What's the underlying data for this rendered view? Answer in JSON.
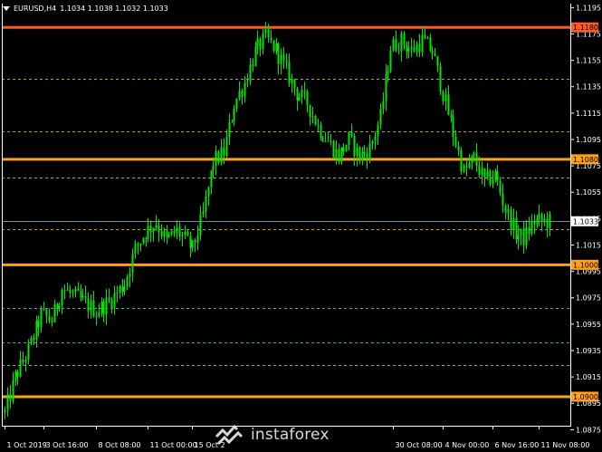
{
  "header": {
    "symbol_timeframe": "EURUSD,H4",
    "ohlc": "1.1034 1.1038 1.1032 1.1033"
  },
  "watermark": {
    "text": "instaforex"
  },
  "colors": {
    "background": "#000000",
    "candle": "#00e600",
    "axis": "#ffffff",
    "resistance_red": "#ff5a1f",
    "level_orange": "#ff9f1a",
    "dashed_yellow": "#c8a000",
    "dashed_teal": "#3aa8a8",
    "current_price_line": "#7d8896",
    "current_price_tag": "#ffffff"
  },
  "chart_data": {
    "type": "candlestick",
    "symbol": "EURUSD",
    "timeframe": "H4",
    "ylim": [
      1.0878,
      1.1198
    ],
    "price_ticks": [
      "1.1195",
      "1.1175",
      "1.1155",
      "1.1135",
      "1.1115",
      "1.1095",
      "1.1075",
      "1.1055",
      "1.1035",
      "1.1015",
      "1.0995",
      "1.0975",
      "1.0955",
      "1.0935",
      "1.0915",
      "1.0895",
      "1.0875"
    ],
    "date_ticks": [
      {
        "label": "1 Oct 2019",
        "index": 0
      },
      {
        "label": "3 Oct 16:00",
        "index": 15
      },
      {
        "label": "8 Oct 08:00",
        "index": 35
      },
      {
        "label": "11 Oct 00:00",
        "index": 55
      },
      {
        "label": "15 Oct 2",
        "index": 72
      },
      {
        "label": "30 Oct 08:00",
        "index": 149
      },
      {
        "label": "4 Nov 00:00",
        "index": 168
      },
      {
        "label": "6 Nov 16:00",
        "index": 187
      },
      {
        "label": "11 Nov 08:00",
        "index": 205
      }
    ],
    "candle_count": 210,
    "levels": [
      {
        "price": 1.118,
        "label": "1.1180",
        "style": "solid",
        "color": "resistance_red"
      },
      {
        "price": 1.108,
        "label": "1.1080",
        "style": "solid",
        "color": "level_orange"
      },
      {
        "price": 1.1,
        "label": "1.1000",
        "style": "solid",
        "color": "level_orange"
      },
      {
        "price": 1.09,
        "label": "1.0900",
        "style": "solid",
        "color": "level_orange"
      },
      {
        "price": 1.1141,
        "style": "dashed",
        "color": "dashed_yellow"
      },
      {
        "price": 1.1101,
        "style": "dashed",
        "color": "dashed_yellow"
      },
      {
        "price": 1.1066,
        "style": "dashed",
        "color": "dashed_yellow"
      },
      {
        "price": 1.1027,
        "style": "dashed",
        "color": "dashed_yellow"
      },
      {
        "price": 1.0924,
        "style": "dashed",
        "color": "dashed_yellow"
      },
      {
        "price": 1.0967,
        "style": "dashed",
        "color": "dashed_teal"
      },
      {
        "price": 1.0941,
        "style": "dashed",
        "color": "dashed_teal"
      }
    ],
    "current_price": {
      "price": 1.1033,
      "label": "1.1033"
    },
    "path_anchors": [
      [
        0,
        1.0888
      ],
      [
        4,
        1.0915
      ],
      [
        9,
        1.0935
      ],
      [
        14,
        1.0962
      ],
      [
        18,
        1.0958
      ],
      [
        22,
        1.0982
      ],
      [
        30,
        1.0972
      ],
      [
        35,
        1.0965
      ],
      [
        40,
        1.0972
      ],
      [
        46,
        1.0986
      ],
      [
        50,
        1.1012
      ],
      [
        54,
        1.1025
      ],
      [
        58,
        1.1032
      ],
      [
        62,
        1.1018
      ],
      [
        66,
        1.1026
      ],
      [
        72,
        1.1012
      ],
      [
        76,
        1.1038
      ],
      [
        80,
        1.1078
      ],
      [
        84,
        1.1085
      ],
      [
        88,
        1.1122
      ],
      [
        92,
        1.1138
      ],
      [
        96,
        1.1162
      ],
      [
        100,
        1.1172
      ],
      [
        104,
        1.1163
      ],
      [
        108,
        1.1147
      ],
      [
        112,
        1.113
      ],
      [
        116,
        1.1123
      ],
      [
        120,
        1.1105
      ],
      [
        124,
        1.1094
      ],
      [
        128,
        1.1082
      ],
      [
        132,
        1.1095
      ],
      [
        136,
        1.1082
      ],
      [
        140,
        1.1088
      ],
      [
        144,
        1.1112
      ],
      [
        148,
        1.1165
      ],
      [
        152,
        1.117
      ],
      [
        156,
        1.1162
      ],
      [
        160,
        1.117
      ],
      [
        164,
        1.1162
      ],
      [
        168,
        1.113
      ],
      [
        172,
        1.11
      ],
      [
        176,
        1.107
      ],
      [
        180,
        1.1081
      ],
      [
        184,
        1.1063
      ],
      [
        188,
        1.1068
      ],
      [
        192,
        1.1042
      ],
      [
        196,
        1.1024
      ],
      [
        199,
        1.102
      ],
      [
        203,
        1.1033
      ],
      [
        209,
        1.1033
      ]
    ]
  }
}
